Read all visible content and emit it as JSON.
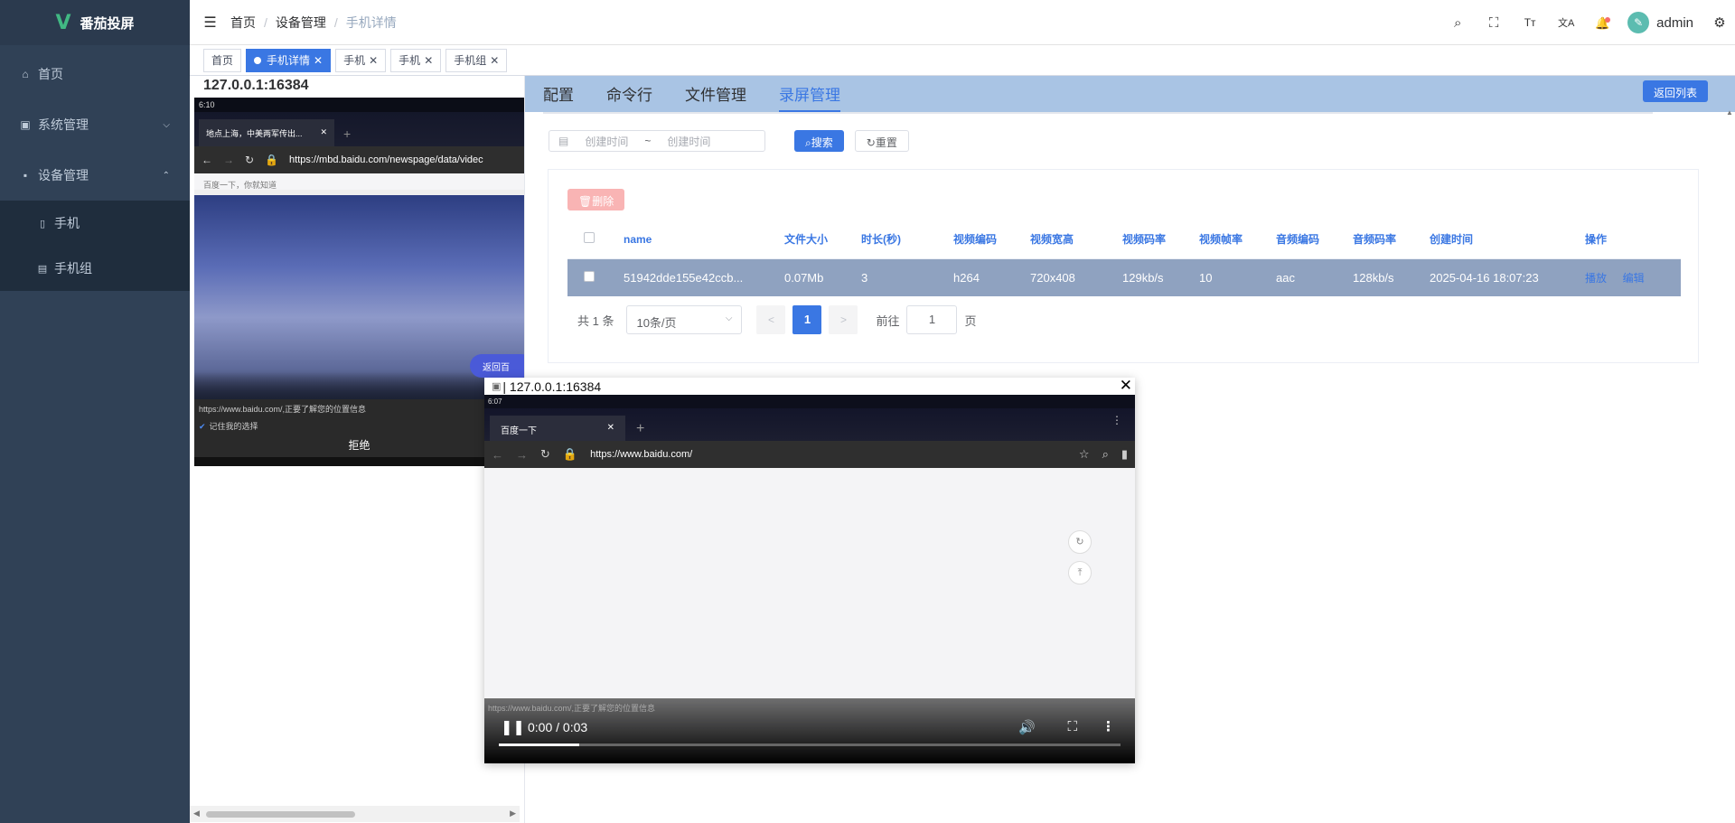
{
  "app": {
    "logo_mark": "V",
    "title": "番茄投屏"
  },
  "sidebar": {
    "items": [
      {
        "label": "首页",
        "icon": "home-icon",
        "glyph": "⌂"
      },
      {
        "label": "系统管理",
        "icon": "monitor-icon",
        "glyph": "▣",
        "arrow": "⌵"
      },
      {
        "label": "设备管理",
        "icon": "display-icon",
        "glyph": "▪",
        "arrow": "⌃"
      }
    ],
    "sub_items": [
      {
        "label": "手机",
        "icon": "phone-icon",
        "glyph": "▯"
      },
      {
        "label": "手机组",
        "icon": "phone-group-icon",
        "glyph": "▤"
      }
    ]
  },
  "navbar": {
    "breadcrumb": [
      "首页",
      "设备管理",
      "手机详情"
    ],
    "separator": "/",
    "username": "admin",
    "avatar_glyph": "✎",
    "icons": [
      "search-icon",
      "fullscreen-icon",
      "font-size-icon",
      "translate-icon",
      "bell-icon",
      "settings-icon"
    ],
    "glyphs": {
      "hamburger": "☰",
      "search": "⌕",
      "fullscreen": "⛶",
      "font": "Tт",
      "translate": "文A",
      "bell": "🔔",
      "settings": "⚙"
    }
  },
  "tags": [
    {
      "label": "首页",
      "active": false,
      "closable": false
    },
    {
      "label": "手机详情",
      "active": true,
      "closable": true
    },
    {
      "label": "手机",
      "active": false,
      "closable": true
    },
    {
      "label": "手机",
      "active": false,
      "closable": true
    },
    {
      "label": "手机组",
      "active": false,
      "closable": true
    }
  ],
  "tag_close": "✕",
  "device": {
    "address": "127.0.0.1:16384",
    "screen": {
      "status_time": "6:10",
      "tab_title": "地点上海，中美两军传出...",
      "url": "https://mbd.baidu.com/newspage/data/videc",
      "search_placeholder": "百度一下，你就知道",
      "pill": "返回百",
      "footer_url": "https://www.baidu.com/,正要了解您的位置信息",
      "remember": "记住我的选择",
      "refuse": "拒绝"
    }
  },
  "tabs": {
    "items": [
      "配置",
      "命令行",
      "文件管理",
      "录屏管理"
    ],
    "active_index": 3,
    "back_button": "返回列表"
  },
  "filter": {
    "start_placeholder": "创建时间",
    "range_separator": "~",
    "end_placeholder": "创建时间",
    "search_button": "搜索",
    "reset_button": "重置"
  },
  "toolbar": {
    "delete_button": "删除"
  },
  "table": {
    "columns": [
      "name",
      "文件大小",
      "时长(秒)",
      "视频编码",
      "视频宽高",
      "视频码率",
      "视频帧率",
      "音频编码",
      "音频码率",
      "创建时间",
      "操作"
    ],
    "rows": [
      {
        "name": "51942dde155e42ccb...",
        "size": "0.07Mb",
        "duration": "3",
        "vcodec": "h264",
        "resolution": "720x408",
        "vbitrate": "129kb/s",
        "fps": "10",
        "acodec": "aac",
        "abitrate": "128kb/s",
        "created": "2025-04-16 18:07:23",
        "play": "播放",
        "edit": "编辑"
      }
    ]
  },
  "pagination": {
    "total": "共 1 条",
    "page_size": "10条/页",
    "current": "1",
    "goto_label": "前往",
    "goto_value": "1",
    "page_unit": "页"
  },
  "video_window": {
    "title": "| 127.0.0.1:16384",
    "close": "✕",
    "status_time": "6:07",
    "tab_title": "百度一下",
    "url": "https://www.baidu.com/",
    "caption": "https://www.baidu.com/,正要了解您的位置信息",
    "time": "0:00 / 0:03",
    "progress": 0.13,
    "glyphs": {
      "pause": "❚❚",
      "volume": "🔊",
      "fullscreen": "⛶",
      "more": "⋮",
      "refresh": "↻",
      "top": "⤒"
    }
  }
}
